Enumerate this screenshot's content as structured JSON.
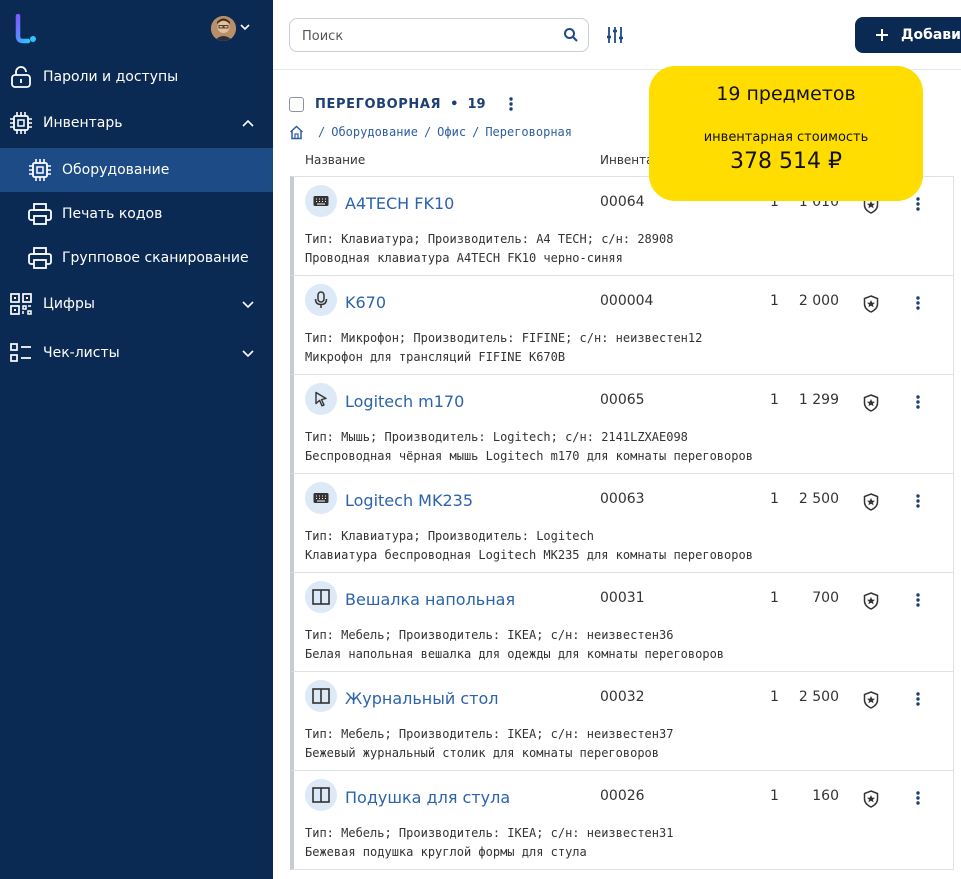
{
  "sidebar": {
    "items": [
      {
        "label": "Пароли и доступы",
        "icon": "lock-icon"
      },
      {
        "label": "Инвентарь",
        "icon": "chip-icon"
      },
      {
        "label": "Оборудование",
        "icon": "chip-icon"
      },
      {
        "label": "Печать кодов",
        "icon": "printer-icon"
      },
      {
        "label": "Групповое сканирование",
        "icon": "printer-icon"
      },
      {
        "label": "Цифры",
        "icon": "qr-icon"
      },
      {
        "label": "Чек-листы",
        "icon": "checklist-icon"
      }
    ]
  },
  "topbar": {
    "search_placeholder": "Поиск",
    "add_label": "Добавить"
  },
  "group": {
    "name": "ПЕРЕГОВОРНАЯ",
    "count": "19"
  },
  "breadcrumb": [
    "Оборудование",
    "Офис",
    "Переговорная"
  ],
  "columns": {
    "name": "Название",
    "inventory": "Инвентарный"
  },
  "summary": {
    "items": "19 предметов",
    "value_label": "инвентарная стоимость",
    "value": "378 514 ₽"
  },
  "rows": [
    {
      "name": "A4TECH FK10",
      "inv": "00064",
      "qty": "1",
      "price": "1 010",
      "icon": "keyboard-icon",
      "line1": "Тип: Клавиатура; Производитель: A4 TECH; с/н: 28908",
      "line2": "Проводная клавиатура A4TECH FK10 черно-синяя"
    },
    {
      "name": "K670",
      "inv": "000004",
      "qty": "1",
      "price": "2 000",
      "icon": "microphone-icon",
      "line1": "Тип: Микрофон; Производитель: FIFINE; с/н: неизвестен12",
      "line2": "Микрофон для трансляций FIFINE K670B"
    },
    {
      "name": "Logitech m170",
      "inv": "00065",
      "qty": "1",
      "price": "1 299",
      "icon": "cursor-icon",
      "line1": "Тип: Мышь; Производитель: Logitech; с/н: 2141LZXAE098",
      "line2": "Беспроводная чёрная мышь Logitech m170 для комнаты переговоров"
    },
    {
      "name": "Logitech MK235",
      "inv": "00063",
      "qty": "1",
      "price": "2 500",
      "icon": "keyboard-icon",
      "line1": "Тип: Клавиатура; Производитель: Logitech",
      "line2": "Клавиатура беспроводная Logitech MK235 для комнаты переговоров"
    },
    {
      "name": "Вешалка напольная",
      "inv": "00031",
      "qty": "1",
      "price": "700",
      "icon": "wardrobe-icon",
      "line1": "Тип: Мебель; Производитель: IKEA; с/н: неизвестен36",
      "line2": "Белая напольная вешалка для одежды для комнаты переговоров"
    },
    {
      "name": "Журнальный стол",
      "inv": "00032",
      "qty": "1",
      "price": "2 500",
      "icon": "wardrobe-icon",
      "line1": "Тип: Мебель; Производитель: IKEA; с/н: неизвестен37",
      "line2": "Бежевый журнальный столик для комнаты переговоров"
    },
    {
      "name": "Подушка для стула",
      "inv": "00026",
      "qty": "1",
      "price": "160",
      "icon": "wardrobe-icon",
      "line1": "Тип: Мебель; Производитель: IKEA; с/н: неизвестен31",
      "line2": "Бежевая подушка круглой формы для стула"
    }
  ],
  "colors": {
    "sidebar": "#0b2a53",
    "sidebar_active": "#1d4b86",
    "accent": "#2b63ad",
    "summary": "#ffdd00"
  }
}
